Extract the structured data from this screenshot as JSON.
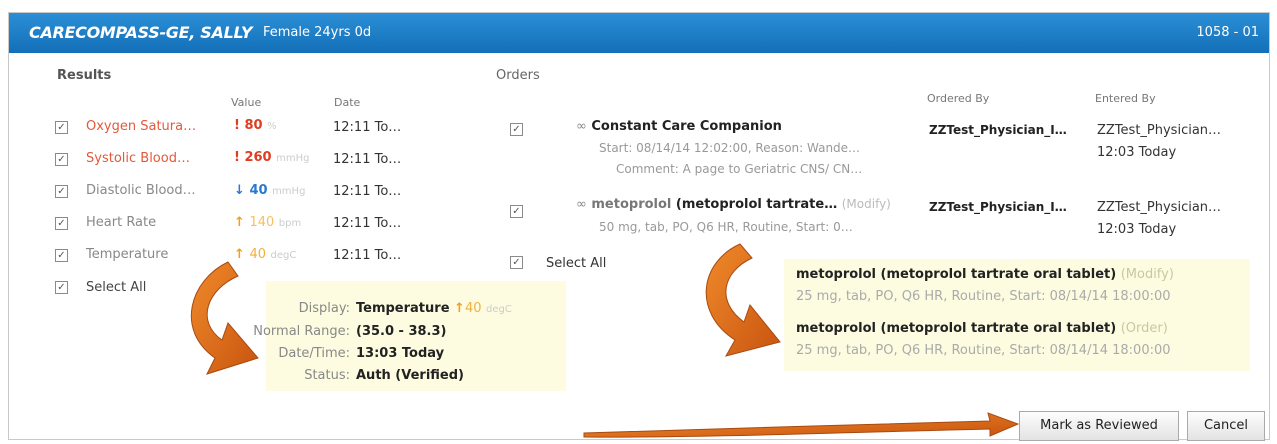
{
  "header": {
    "patient_name": "CARECOMPASS-GE, SALLY",
    "demographics": "Female 24yrs 0d",
    "encounter": "1058 - 01"
  },
  "results": {
    "title": "Results",
    "col_value": "Value",
    "col_date": "Date",
    "rows": [
      {
        "name": "Oxygen Satura…",
        "flag": "!",
        "value": "80",
        "unit": "%",
        "date": "12:11 To…"
      },
      {
        "name": "Systolic Blood…",
        "flag": "!",
        "value": "260",
        "unit": "mmHg",
        "date": "12:11 To…"
      },
      {
        "name": "Diastolic Blood…",
        "flag": "↓",
        "value": "40",
        "unit": "mmHg",
        "date": "12:11 To…"
      },
      {
        "name": "Heart Rate",
        "flag": "↑",
        "value": "140",
        "unit": "bpm",
        "date": "12:11 To…"
      },
      {
        "name": "Temperature",
        "flag": "↑",
        "value": "40",
        "unit": "degC",
        "date": "12:11 To…"
      }
    ],
    "select_all": "Select All"
  },
  "orders": {
    "title": "Orders",
    "col_ordered_by": "Ordered By",
    "col_entered_by": "Entered By",
    "items": [
      {
        "icon": "link-icon",
        "name_prefix": "",
        "name": "Constant Care Companion",
        "status": "",
        "detail1": "Start: 08/14/14 12:02:00, Reason: Wande…",
        "detail2": "Comment: A page to Geriatric CNS/ CN…",
        "ordered_by": "ZZTest_Physician_I…",
        "entered_by": "ZZTest_Physician…",
        "entered_time": "12:03 Today"
      },
      {
        "icon": "link-icon",
        "name_prefix": "metoprolol",
        "name": "(metoprolol tartrate…",
        "status": "(Modify)",
        "detail1": "50 mg, tab, PO, Q6 HR, Routine, Start: 0…",
        "detail2": "",
        "ordered_by": "ZZTest_Physician_I…",
        "entered_by": "ZZTest_Physician…",
        "entered_time": "12:03 Today"
      }
    ],
    "select_all": "Select All"
  },
  "tooltip": {
    "display_label": "Display:",
    "display_value": "Temperature",
    "display_flag": "↑",
    "display_result": "40",
    "display_unit": "degC",
    "range_label": "Normal Range:",
    "range_value": "(35.0 - 38.3)",
    "datetime_label": "Date/Time:",
    "datetime_value": "13:03 Today",
    "status_label": "Status:",
    "status_value": "Auth (Verified)"
  },
  "modify_detail": {
    "old_title": "metoprolol (metoprolol tartrate oral tablet)",
    "old_tag": "(Modify)",
    "old_detail": "25 mg, tab, PO, Q6 HR, Routine, Start: 08/14/14 18:00:00",
    "new_title": "metoprolol (metoprolol tartrate oral tablet)",
    "new_tag": "(Order)",
    "new_detail": "25 mg, tab, PO, Q6 HR, Routine, Start: 08/14/14 18:00:00"
  },
  "buttons": {
    "mark_reviewed": "Mark as Reviewed",
    "cancel": "Cancel"
  },
  "colors": {
    "header": "#1e7fc8",
    "critical": "#e03c20",
    "annotation_arrow": "#e2701f",
    "tooltip_bg": "#fdfce0"
  }
}
